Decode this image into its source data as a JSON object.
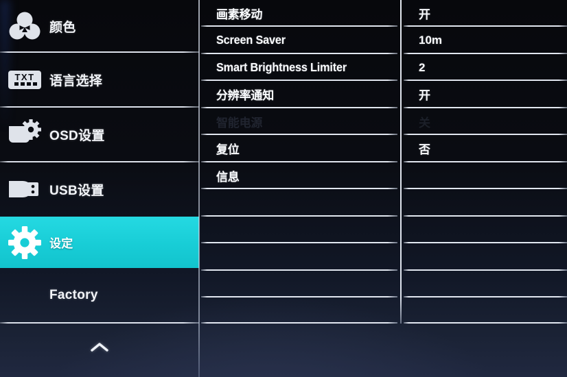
{
  "device_menu": {
    "title": "Monitor OSD Menu",
    "accent_color": "#18cdd6",
    "background_color": "#0a0c12",
    "text_color": "#fafcff",
    "separator_color": "#eef3fc"
  },
  "sidebar": {
    "items": [
      {
        "id": "color",
        "label": "颜色",
        "icon": "color-wheel-icon",
        "selected": false
      },
      {
        "id": "language",
        "label": "语言选择",
        "icon": "txt-language-icon",
        "selected": false
      },
      {
        "id": "osd",
        "label": "OSD设置",
        "icon": "osd-gear-icon",
        "selected": false
      },
      {
        "id": "usb",
        "label": "USB设置",
        "icon": "usb-drive-icon",
        "selected": false
      },
      {
        "id": "setting",
        "label": "设定",
        "icon": "gear-icon",
        "selected": true
      },
      {
        "id": "factory",
        "label": "Factory",
        "icon": "none",
        "selected": false
      }
    ],
    "scroll_indicator": "chevron-up-icon"
  },
  "menu": {
    "rows": [
      {
        "label": "画素移动",
        "value": "开",
        "script": "cjk",
        "disabled": false
      },
      {
        "label": "Screen Saver",
        "value": "10m",
        "script": "latin",
        "disabled": false
      },
      {
        "label": "Smart Brightness Limiter",
        "value": "2",
        "script": "latin",
        "disabled": false
      },
      {
        "label": "分辨率通知",
        "value": "开",
        "script": "cjk",
        "disabled": false
      },
      {
        "label": "智能电源",
        "value": "关",
        "script": "cjk",
        "disabled": true
      },
      {
        "label": "复位",
        "value": "否",
        "script": "cjk",
        "disabled": false
      },
      {
        "label": "信息",
        "value": "",
        "script": "cjk",
        "disabled": false
      },
      {
        "label": "",
        "value": "",
        "script": "cjk",
        "disabled": false
      },
      {
        "label": "",
        "value": "",
        "script": "cjk",
        "disabled": false
      },
      {
        "label": "",
        "value": "",
        "script": "cjk",
        "disabled": false
      },
      {
        "label": "",
        "value": "",
        "script": "cjk",
        "disabled": false
      },
      {
        "label": "",
        "value": "",
        "script": "cjk",
        "disabled": false
      }
    ]
  }
}
